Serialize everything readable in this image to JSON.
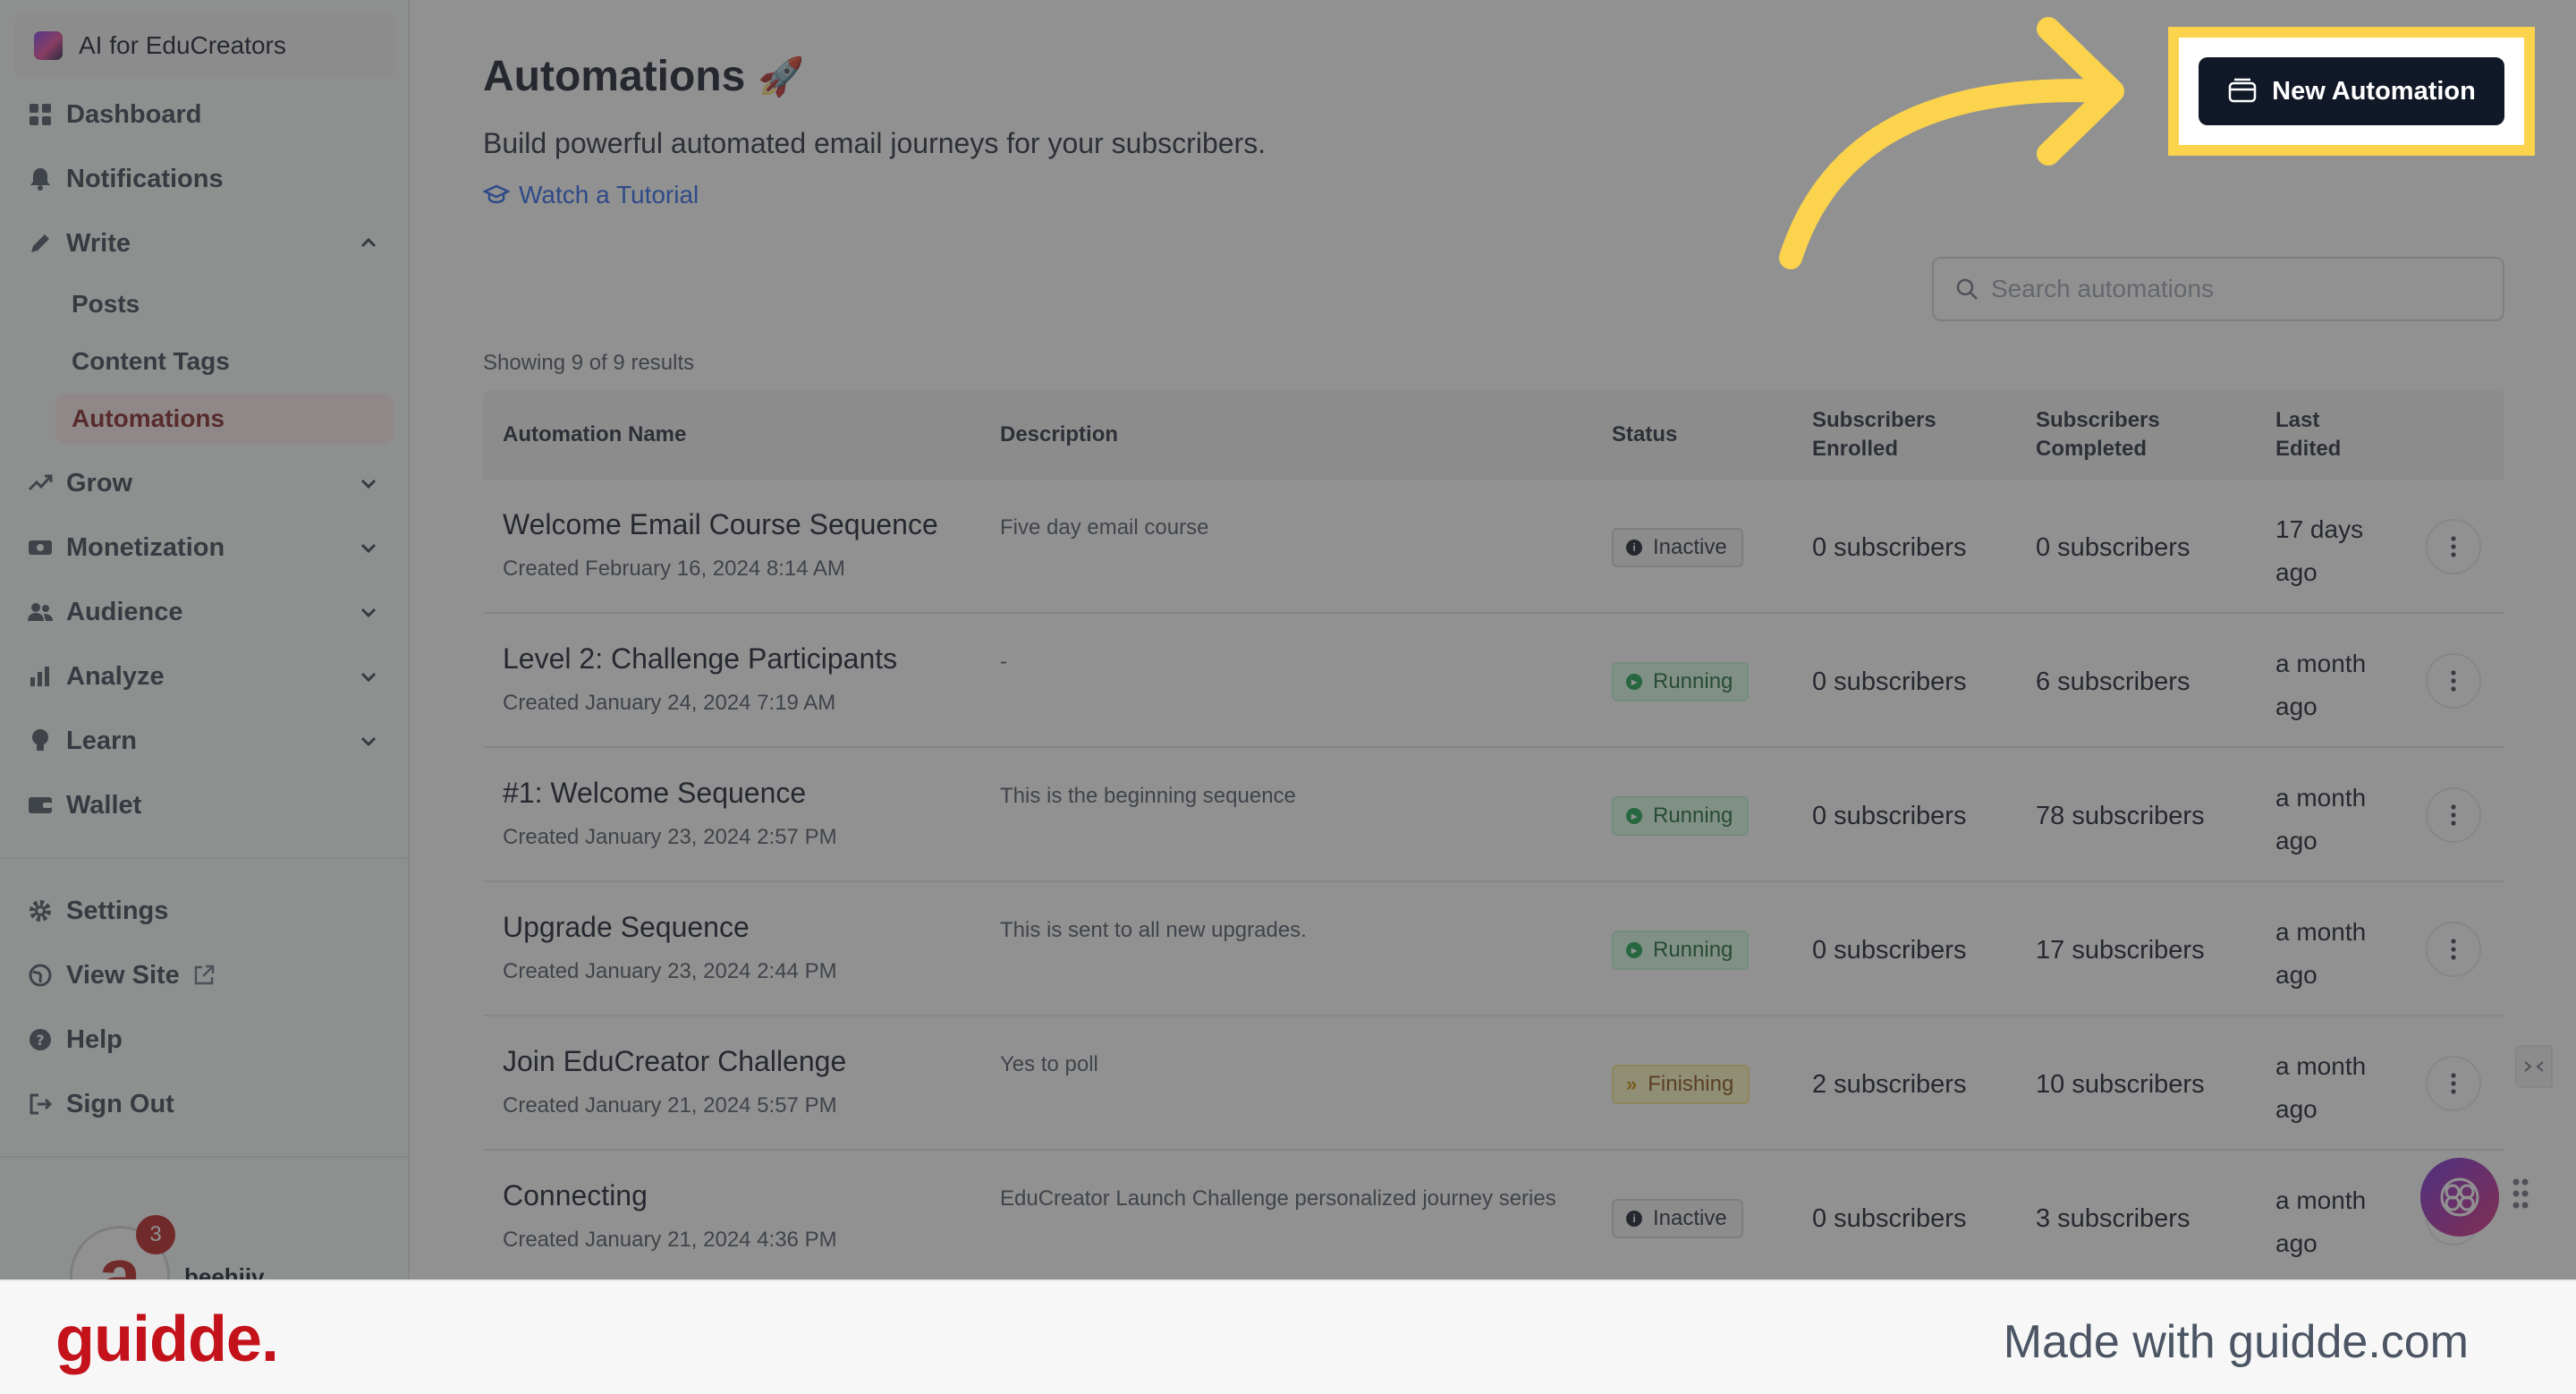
{
  "workspace": {
    "name": "AI for EduCreators"
  },
  "sidebar": {
    "nav": [
      {
        "label": "Dashboard"
      },
      {
        "label": "Notifications"
      },
      {
        "label": "Write"
      },
      {
        "label": "Grow"
      },
      {
        "label": "Monetization"
      },
      {
        "label": "Audience"
      },
      {
        "label": "Analyze"
      },
      {
        "label": "Learn"
      },
      {
        "label": "Wallet"
      }
    ],
    "write_sub": [
      {
        "label": "Posts"
      },
      {
        "label": "Content Tags"
      },
      {
        "label": "Automations"
      }
    ],
    "bottom": [
      {
        "label": "Settings"
      },
      {
        "label": "View Site"
      },
      {
        "label": "Help"
      },
      {
        "label": "Sign Out"
      }
    ],
    "user": {
      "avatar_letter": "a",
      "badge": "3",
      "name": "beehiiv"
    }
  },
  "page": {
    "title": "Automations",
    "title_emoji": "🚀",
    "subtitle": "Build powerful automated email journeys for your subscribers.",
    "tutorial_link": "Watch a Tutorial",
    "new_button": "New Automation",
    "search_placeholder": "Search automations",
    "showing": "Showing 9 of 9 results"
  },
  "table": {
    "headers": {
      "name": "Automation Name",
      "description": "Description",
      "status": "Status",
      "enrolled_1": "Subscribers",
      "enrolled_2": "Enrolled",
      "completed_1": "Subscribers",
      "completed_2": "Completed",
      "edited_1": "Last",
      "edited_2": "Edited"
    },
    "rows": [
      {
        "name": "Welcome Email Course Sequence",
        "created": "Created February 16, 2024 8:14 AM",
        "description": "Five day email course",
        "status": "Inactive",
        "enrolled": "0 subscribers",
        "completed": "0 subscribers",
        "edited": "17 days ago"
      },
      {
        "name": "Level 2: Challenge Participants",
        "created": "Created January 24, 2024 7:19 AM",
        "description": "-",
        "status": "Running",
        "enrolled": "0 subscribers",
        "completed": "6 subscribers",
        "edited": "a month ago"
      },
      {
        "name": "#1: Welcome Sequence",
        "created": "Created January 23, 2024 2:57 PM",
        "description": "This is the beginning sequence",
        "status": "Running",
        "enrolled": "0 subscribers",
        "completed": "78 subscribers",
        "edited": "a month ago"
      },
      {
        "name": "Upgrade Sequence",
        "created": "Created January 23, 2024 2:44 PM",
        "description": "This is sent to all new upgrades.",
        "status": "Running",
        "enrolled": "0 subscribers",
        "completed": "17 subscribers",
        "edited": "a month ago"
      },
      {
        "name": "Join EduCreator Challenge",
        "created": "Created January 21, 2024 5:57 PM",
        "description": "Yes to poll",
        "status": "Finishing",
        "enrolled": "2 subscribers",
        "completed": "10 subscribers",
        "edited": "a month ago"
      },
      {
        "name": "Connecting",
        "created": "Created January 21, 2024 4:36 PM",
        "description": "EduCreator Launch Challenge personalized journey series",
        "status": "Inactive",
        "enrolled": "0 subscribers",
        "completed": "3 subscribers",
        "edited": "a month ago"
      }
    ]
  },
  "footer": {
    "brand": "guidde.",
    "made_with": "Made with guidde.com"
  },
  "colors": {
    "highlight": "#fcd34d",
    "primary_button": "#111827",
    "brand_red": "#c4121b",
    "link": "#2563eb"
  }
}
